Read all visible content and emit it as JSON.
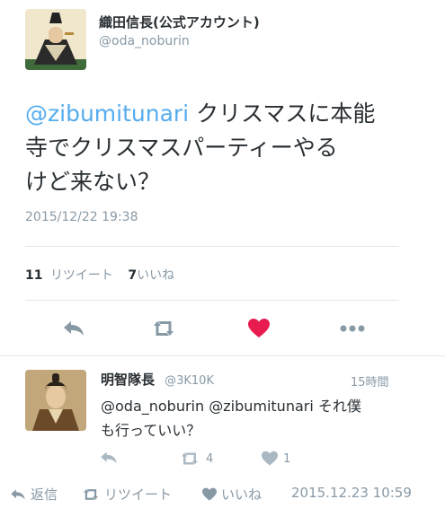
{
  "tweet": {
    "display_name": "織田信長(公式アカウント)",
    "handle": "@oda_noburin",
    "mention": "@zibumitunari",
    "line1_rest": " クリスマスに本能",
    "line2": "寺でクリスマスパーティーやる",
    "line3": "けど来ない？",
    "timestamp": "2015/12/22 19:38",
    "retweet_count": "11",
    "retweet_label": "リツイート",
    "like_count": "7",
    "like_label": "いいね",
    "actions": [
      {
        "icon": "reply-icon"
      },
      {
        "icon": "retweet-icon"
      },
      {
        "icon": "heart-icon",
        "active": true
      },
      {
        "icon": "more-icon"
      }
    ]
  },
  "reply": {
    "display_name": "明智隊長",
    "handle": "@3K10K",
    "time_ago": "15時間",
    "text_line1": "@oda_noburin @zibumitunari それ僕",
    "text_line2": "も行っていい？",
    "retweet_count": "4",
    "like_count": "1"
  },
  "footer": {
    "reply_label": "返信",
    "retweet_label": "リツイート",
    "like_label": "いいね",
    "timestamp": "2015.12.23 10:59"
  },
  "colors": {
    "accent": "#55acee",
    "like_active": "#e81c4f",
    "muted": "#8899a6",
    "text": "#292f33"
  }
}
